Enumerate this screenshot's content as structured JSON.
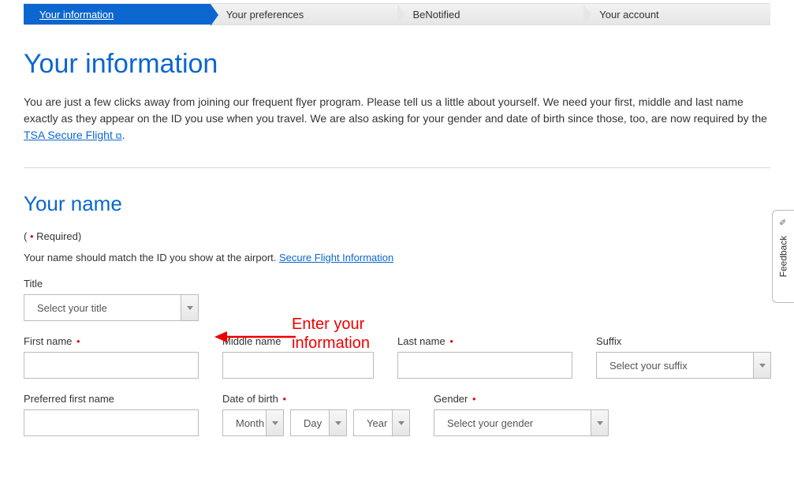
{
  "stepper": {
    "steps": [
      {
        "label": "Your information",
        "active": true
      },
      {
        "label": "Your preferences",
        "active": false
      },
      {
        "label": "BeNotified",
        "active": false
      },
      {
        "label": "Your account",
        "active": false
      }
    ]
  },
  "heading": "Your information",
  "intro": {
    "text_before_link": "You are just a few clicks away from joining our frequent flyer program. Please tell us a little about yourself. We need your first, middle and last name exactly as they appear on the ID you use when you travel. We are also asking for your gender and date of birth since those, too, are now required by the ",
    "link_text": "TSA Secure Flight",
    "after": "."
  },
  "section_heading": "Your name",
  "required_note": {
    "open": "( ",
    "dot": "•",
    "label": " Required)"
  },
  "hint": {
    "text": "Your name should match the ID you show at the airport. ",
    "link": "Secure Flight Information"
  },
  "fields": {
    "title": {
      "label": "Title",
      "placeholder": "Select your title"
    },
    "first": {
      "label": "First name"
    },
    "middle": {
      "label": "Middle name"
    },
    "last": {
      "label": "Last name"
    },
    "suffix": {
      "label": "Suffix",
      "placeholder": "Select your suffix"
    },
    "preferred": {
      "label": "Preferred first name"
    },
    "dob": {
      "label": "Date of birth",
      "month": "Month",
      "day": "Day",
      "year": "Year"
    },
    "gender": {
      "label": "Gender",
      "placeholder": "Select your gender"
    }
  },
  "annotation": {
    "line1": "Enter your",
    "line2": "information"
  },
  "feedback": {
    "label": "Feedback"
  }
}
